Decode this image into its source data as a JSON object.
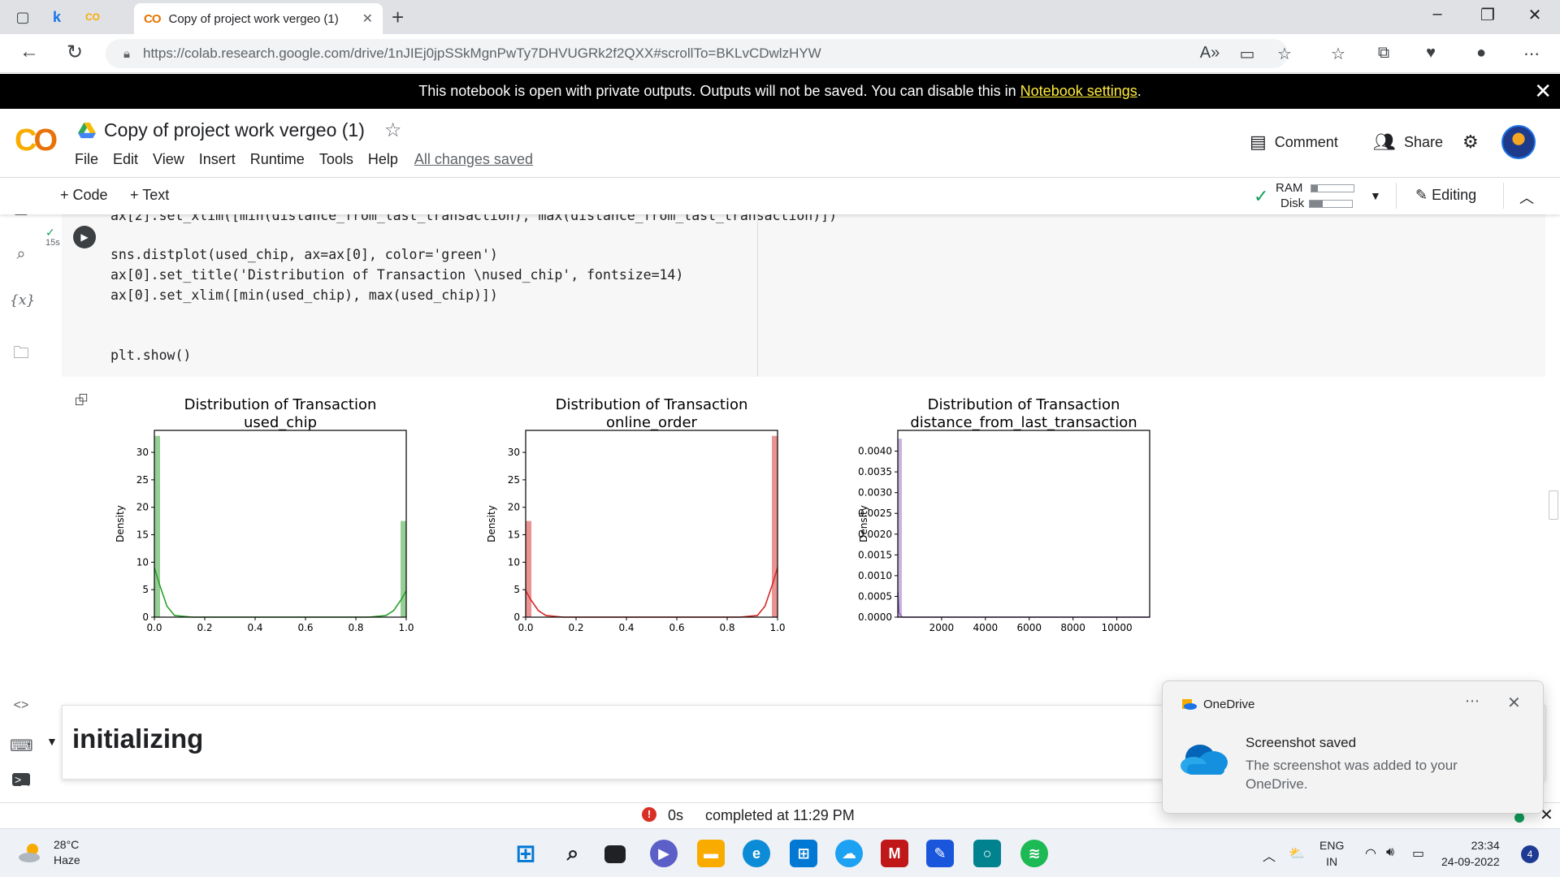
{
  "browser": {
    "tab_title": "Copy of project work vergeo (1)",
    "tab_co_logo": "CO",
    "url": "https://colab.research.google.com/drive/1nJIEj0jpSSkMgnPwTy7DHVUGRk2f2QXX#scrollTo=BKLvCDwlzHYW",
    "pinned_tab_k": "k",
    "pinned_tab_co": "CO"
  },
  "banner": {
    "text": "This notebook is open with private outputs. Outputs will not be saved. You can disable this in",
    "link": "Notebook settings",
    "suffix": "."
  },
  "colab": {
    "logo": "CO",
    "doc_title": "Copy of project work vergeo (1)",
    "menus": [
      "File",
      "Edit",
      "View",
      "Insert",
      "Runtime",
      "Tools",
      "Help"
    ],
    "saved_status": "All changes saved",
    "comment_label": "Comment",
    "share_label": "Share"
  },
  "toolbar": {
    "code_btn": "+ Code",
    "text_btn": "+ Text",
    "ram_label": "RAM",
    "disk_label": "Disk",
    "ram_fill": 0.15,
    "disk_fill": 0.3,
    "editing_label": "Editing"
  },
  "code_cell": {
    "exec_time": "15s",
    "lines": [
      "ax[2].set_xlim([min(distance_from_last_transaction), max(distance_from_last_transaction)])",
      "sns.distplot(used_chip, ax=ax[0], color='green')",
      "ax[0].set_title('Distribution of Transaction \\nused_chip', fontsize=14)",
      "ax[0].set_xlim([min(used_chip), max(used_chip)])",
      "plt.show()"
    ]
  },
  "chart_data": [
    {
      "type": "bar",
      "title": "Distribution of Transaction\nused_chip",
      "ylabel": "Density",
      "xlim": [
        0.0,
        1.0
      ],
      "ylim": [
        0,
        34
      ],
      "xticks": [
        "0.0",
        "0.2",
        "0.4",
        "0.6",
        "0.8",
        "1.0"
      ],
      "yticks": [
        "0",
        "5",
        "10",
        "15",
        "20",
        "25",
        "30"
      ],
      "color": "#2ca02c",
      "bars": [
        {
          "x": 0.0,
          "height": 33
        },
        {
          "x": 1.0,
          "height": 17.5
        }
      ],
      "kde": [
        [
          0.0,
          9.0
        ],
        [
          0.02,
          6.0
        ],
        [
          0.05,
          2.0
        ],
        [
          0.08,
          0.3
        ],
        [
          0.15,
          0
        ],
        [
          0.85,
          0
        ],
        [
          0.92,
          0.3
        ],
        [
          0.95,
          1.2
        ],
        [
          0.98,
          3.2
        ],
        [
          1.0,
          4.8
        ]
      ]
    },
    {
      "type": "bar",
      "title": "Distribution of Transaction\nonline_order",
      "ylabel": "Density",
      "xlim": [
        0.0,
        1.0
      ],
      "ylim": [
        0,
        34
      ],
      "xticks": [
        "0.0",
        "0.2",
        "0.4",
        "0.6",
        "0.8",
        "1.0"
      ],
      "yticks": [
        "0",
        "5",
        "10",
        "15",
        "20",
        "25",
        "30"
      ],
      "color": "#d62728",
      "bars": [
        {
          "x": 0.0,
          "height": 17.5
        },
        {
          "x": 1.0,
          "height": 33
        }
      ],
      "kde": [
        [
          0.0,
          4.8
        ],
        [
          0.02,
          3.2
        ],
        [
          0.05,
          1.2
        ],
        [
          0.08,
          0.3
        ],
        [
          0.15,
          0
        ],
        [
          0.85,
          0
        ],
        [
          0.92,
          0.3
        ],
        [
          0.95,
          2.0
        ],
        [
          0.98,
          6.0
        ],
        [
          1.0,
          9.0
        ]
      ]
    },
    {
      "type": "bar",
      "title": "Distribution of Transaction\ndistance_from_last_transaction",
      "ylabel": "Density",
      "xlim": [
        0,
        11500
      ],
      "ylim": [
        0,
        0.0045
      ],
      "xticks": [
        "2000",
        "4000",
        "6000",
        "8000",
        "10000"
      ],
      "yticks": [
        "0.0000",
        "0.0005",
        "0.0010",
        "0.0015",
        "0.0020",
        "0.0025",
        "0.0030",
        "0.0035",
        "0.0040"
      ],
      "color": "#9467bd",
      "bars": [
        {
          "x": 0,
          "height": 0.0043
        }
      ],
      "kde": [
        [
          0,
          0.0006
        ],
        [
          60,
          0.0001
        ],
        [
          200,
          0
        ],
        [
          11500,
          0
        ]
      ]
    }
  ],
  "text_cell": {
    "heading": "initializing"
  },
  "statusbar": {
    "duration": "0s",
    "completed": "completed at 11:29 PM"
  },
  "toast": {
    "app": "OneDrive",
    "title": "Screenshot saved",
    "body": "The screenshot was added to your OneDrive."
  },
  "taskbar": {
    "temp": "28°C",
    "weather": "Haze",
    "lang1": "ENG",
    "lang2": "IN",
    "time": "23:34",
    "date": "24-09-2022",
    "notifications": "4"
  }
}
